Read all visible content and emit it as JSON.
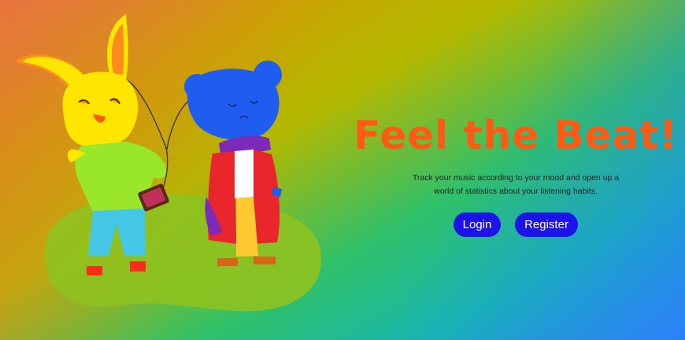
{
  "hero": {
    "title": "Feel the Beat!",
    "subtitle": "Track your music according to your mood and open up a world of statistics about your listening habits."
  },
  "buttons": {
    "login": "Login",
    "register": "Register"
  },
  "colors": {
    "title": "#ff5a14",
    "button": "#1d12e8",
    "button_text": "#ffffff"
  },
  "illustration": {
    "characters": [
      "rabbit",
      "bear"
    ],
    "icons": [
      "rabbit-icon",
      "bear-icon",
      "phone-icon",
      "earphones-icon"
    ]
  }
}
